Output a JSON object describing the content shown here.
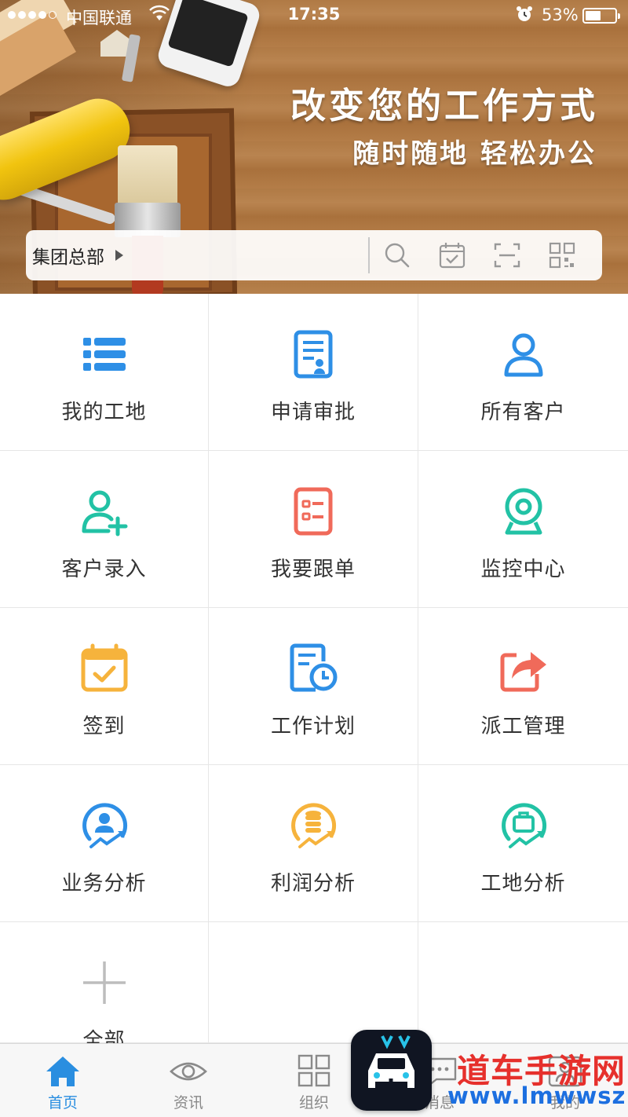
{
  "status": {
    "carrier": "中国联通",
    "time": "17:35",
    "battery_pct": "53%",
    "battery_level": 0.53
  },
  "hero": {
    "title": "改变您的工作方式",
    "subtitle": "随时随地 轻松办公"
  },
  "searchbar": {
    "org_label": "集团总部",
    "icons": [
      "search-icon",
      "calendar-check-icon",
      "scan-icon",
      "qr-code-icon"
    ]
  },
  "grid": [
    {
      "label": "我的工地",
      "icon": "list-icon",
      "color": "#2e8fe6"
    },
    {
      "label": "申请审批",
      "icon": "document-approval-icon",
      "color": "#2e8fe6"
    },
    {
      "label": "所有客户",
      "icon": "user-icon",
      "color": "#2e8fe6"
    },
    {
      "label": "客户录入",
      "icon": "add-user-icon",
      "color": "#22c2a5"
    },
    {
      "label": "我要跟单",
      "icon": "checklist-icon",
      "color": "#f06a5a"
    },
    {
      "label": "监控中心",
      "icon": "webcam-icon",
      "color": "#22c2a5"
    },
    {
      "label": "签到",
      "icon": "calendar-check-icon",
      "color": "#f6b33c"
    },
    {
      "label": "工作计划",
      "icon": "schedule-icon",
      "color": "#2e8fe6"
    },
    {
      "label": "派工管理",
      "icon": "share-icon",
      "color": "#f06a5a"
    },
    {
      "label": "业务分析",
      "icon": "user-trend-icon",
      "color": "#2e8fe6"
    },
    {
      "label": "利润分析",
      "icon": "coins-trend-icon",
      "color": "#f6b33c"
    },
    {
      "label": "工地分析",
      "icon": "briefcase-trend-icon",
      "color": "#22c2a5"
    },
    {
      "label": "全部",
      "icon": "plus-icon",
      "color": "#bdbdbd"
    }
  ],
  "tabs": [
    {
      "label": "首页",
      "icon": "home-icon",
      "active": true
    },
    {
      "label": "资讯",
      "icon": "eye-icon",
      "active": false
    },
    {
      "label": "组织",
      "icon": "grid-icon",
      "active": false
    },
    {
      "label": "消息",
      "icon": "chat-icon",
      "active": false
    },
    {
      "label": "我的",
      "icon": "profile-icon",
      "active": false
    }
  ],
  "watermark": {
    "name": "道车手游网",
    "url": "www.lmwwsz.com"
  },
  "colors": {
    "accent": "#2a8ee0",
    "blue": "#2e8fe6",
    "teal": "#22c2a5",
    "coral": "#f06a5a",
    "yellow": "#f6b33c"
  }
}
